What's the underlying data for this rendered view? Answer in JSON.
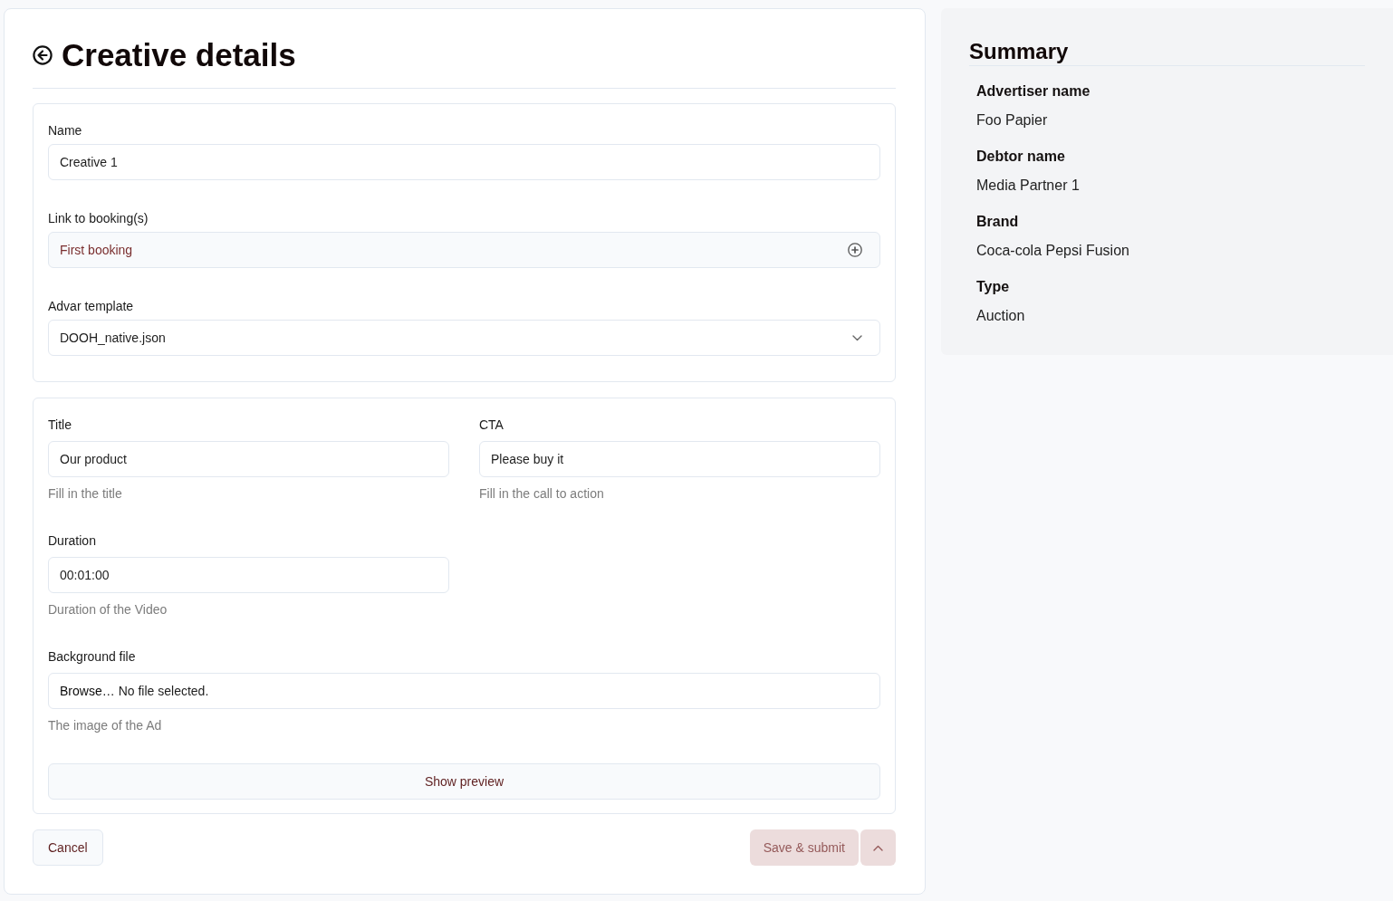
{
  "header": {
    "title": "Creative details"
  },
  "booking_section": {
    "fields": [
      {
        "kind": "text",
        "label": "Name",
        "value": "Creative 1"
      },
      {
        "kind": "picker",
        "label": "Link to booking(s)",
        "value": "First booking"
      },
      {
        "kind": "select",
        "label": "Advar template",
        "value": "DOOH_native.json"
      }
    ]
  },
  "content_section": {
    "fields": [
      {
        "kind": "text",
        "label": "Title",
        "value": "Our product",
        "hint": "Fill in the title"
      },
      {
        "kind": "text",
        "label": "CTA",
        "value": "Please buy it",
        "hint": "Fill in the call to action"
      },
      {
        "kind": "text",
        "label": "Duration",
        "value": "00:01:00",
        "hint": "Duration of the Video"
      },
      {
        "kind": "file",
        "label": "Background file",
        "button": "Browse…",
        "value": "No file selected.",
        "hint": "The image of the Ad"
      }
    ],
    "preview_button": "Show preview"
  },
  "actions": {
    "cancel_button": "Cancel",
    "submit_button": {
      "label": "Save & submit",
      "disabled": true
    }
  },
  "summary": {
    "title": "Summary",
    "items": [
      {
        "label": "Advertiser name",
        "value": "Foo Papier"
      },
      {
        "label": "Debtor name",
        "value": "Media Partner 1"
      },
      {
        "label": "Brand",
        "value": "Coca-cola Pepsi Fusion"
      },
      {
        "label": "Type",
        "value": "Auction"
      }
    ]
  }
}
